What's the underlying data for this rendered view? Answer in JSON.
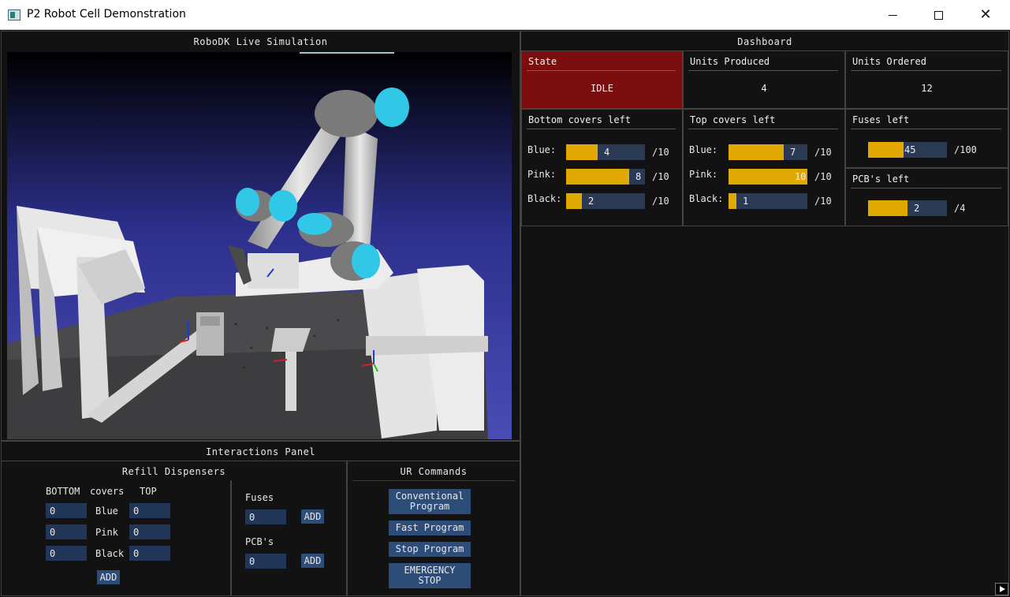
{
  "window": {
    "title": "P2 Robot Cell Demonstration",
    "icons": [
      "app-icon",
      "minimize-icon",
      "maximize-icon",
      "close-icon"
    ],
    "close_glyph": "✕"
  },
  "simulation": {
    "title": "RoboDK Live Simulation"
  },
  "dashboard": {
    "title": "Dashboard",
    "state": {
      "label": "State",
      "value": "IDLE",
      "color": "#7a0e0e"
    },
    "units_produced": {
      "label": "Units Produced",
      "value": "4"
    },
    "units_ordered": {
      "label": "Units Ordered",
      "value": "12"
    },
    "bottom_covers": {
      "label": "Bottom covers left",
      "rows": [
        {
          "name": "Blue:",
          "value": "4",
          "fraction": 0.4,
          "max": "/10"
        },
        {
          "name": "Pink:",
          "value": "8",
          "fraction": 0.8,
          "max": "/10"
        },
        {
          "name": "Black:",
          "value": "2",
          "fraction": 0.2,
          "max": "/10"
        }
      ]
    },
    "top_covers": {
      "label": "Top covers left",
      "rows": [
        {
          "name": "Blue:",
          "value": "7",
          "fraction": 0.7,
          "max": "/10"
        },
        {
          "name": "Pink:",
          "value": "10",
          "fraction": 1.0,
          "max": "/10"
        },
        {
          "name": "Black:",
          "value": "1",
          "fraction": 0.1,
          "max": "/10"
        }
      ]
    },
    "fuses": {
      "label": "Fuses left",
      "value": "45",
      "fraction": 0.45,
      "max": "/100"
    },
    "pcbs": {
      "label": "PCB's left",
      "value": "2",
      "fraction": 0.5,
      "max": "/4"
    },
    "bar_color": "#e0a800",
    "bar_bg": "#2a3a55"
  },
  "interactions": {
    "title": "Interactions Panel",
    "refill": {
      "title": "Refill Dispensers",
      "header_bottom": "BOTTOM",
      "header_covers": "covers",
      "header_top": "TOP",
      "rows": [
        {
          "name": "Blue",
          "bottom": "0",
          "top": "0"
        },
        {
          "name": "Pink",
          "bottom": "0",
          "top": "0"
        },
        {
          "name": "Black",
          "bottom": "0",
          "top": "0"
        }
      ],
      "add_label": "ADD"
    },
    "fuses": {
      "label": "Fuses",
      "value": "0",
      "add_label": "ADD"
    },
    "pcbs": {
      "label": "PCB's",
      "value": "0",
      "add_label": "ADD"
    },
    "ur_commands": {
      "title": "UR Commands",
      "conventional_line1": "Conventional",
      "conventional_line2": "Program",
      "fast": "Fast Program",
      "stop": "Stop Program",
      "emergency_line1": "EMERGENCY",
      "emergency_line2": "STOP"
    }
  }
}
